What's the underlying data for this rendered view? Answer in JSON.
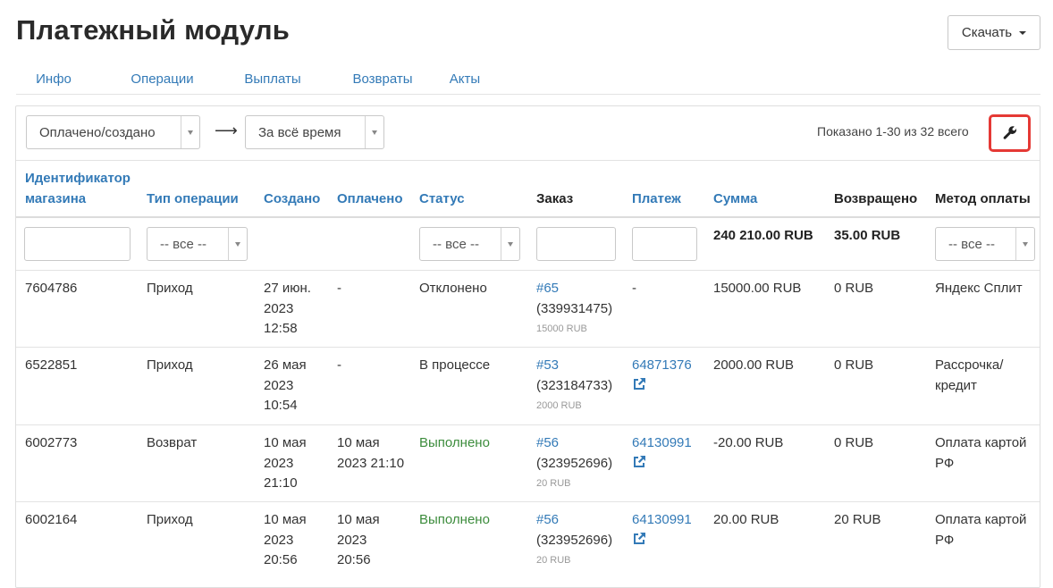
{
  "title": "Платежный модуль",
  "download_label": "Скачать",
  "tabs": [
    {
      "label": "Инфо"
    },
    {
      "label": "Операции"
    },
    {
      "label": "Выплаты"
    },
    {
      "label": "Возвраты"
    },
    {
      "label": "Акты"
    }
  ],
  "active_tab": "Операции",
  "filters": {
    "date_type": "Оплачено/создано",
    "arrow": "⟶",
    "period": "За всё время",
    "shown": "Показано 1-30 из 32 всего"
  },
  "columns": {
    "shop_id": "Идентификатор магазина",
    "op_type": "Тип операции",
    "created": "Создано",
    "paid": "Оплачено",
    "status": "Статус",
    "order": "Заказ",
    "payment": "Платеж",
    "amount": "Сумма",
    "refunded": "Возвращено",
    "method": "Метод оплаты"
  },
  "column_filters": {
    "op_type": "-- все --",
    "status": "-- все --",
    "method": "-- все --"
  },
  "totals": {
    "amount": "240 210.00 RUB",
    "refunded": "35.00 RUB"
  },
  "rows": [
    {
      "shop_id": "7604786",
      "op_type": "Приход",
      "created": [
        "27 июн.",
        "2023",
        "12:58"
      ],
      "paid": [
        "-"
      ],
      "status": "Отклонено",
      "status_ok": false,
      "order_link": "#65",
      "order_id": "(339931475)",
      "order_sum": "15000 RUB",
      "payment": "-",
      "payment_link": false,
      "amount": "15000.00 RUB",
      "refunded": "0 RUB",
      "method": [
        "Яндекс Сплит"
      ]
    },
    {
      "shop_id": "6522851",
      "op_type": "Приход",
      "created": [
        "26 мая",
        "2023",
        "10:54"
      ],
      "paid": [
        "-"
      ],
      "status": "В процессе",
      "status_ok": false,
      "order_link": "#53",
      "order_id": "(323184733)",
      "order_sum": "2000 RUB",
      "payment": "64871376",
      "payment_link": true,
      "amount": "2000.00 RUB",
      "refunded": "0 RUB",
      "method": [
        "Рассрочка/",
        "кредит"
      ]
    },
    {
      "shop_id": "6002773",
      "op_type": "Возврат",
      "created": [
        "10 мая",
        "2023",
        "21:10"
      ],
      "paid": [
        "10 мая",
        "2023 21:10"
      ],
      "status": "Выполнено",
      "status_ok": true,
      "order_link": "#56",
      "order_id": "(323952696)",
      "order_sum": "20 RUB",
      "payment": "64130991",
      "payment_link": true,
      "amount": "-20.00 RUB",
      "refunded": "0 RUB",
      "method": [
        "Оплата картой",
        "РФ"
      ]
    },
    {
      "shop_id": "6002164",
      "op_type": "Приход",
      "created": [
        "10 мая",
        "2023",
        "20:56"
      ],
      "paid": [
        "10 мая",
        "2023",
        "20:56"
      ],
      "status": "Выполнено",
      "status_ok": true,
      "order_link": "#56",
      "order_id": "(323952696)",
      "order_sum": "20 RUB",
      "payment": "64130991",
      "payment_link": true,
      "amount": "20.00 RUB",
      "refunded": "20 RUB",
      "method": [
        "Оплата картой",
        "РФ"
      ]
    }
  ],
  "icons": {
    "wrench": "wrench-icon",
    "external_link": "external-link-icon",
    "caret": "caret-down-icon"
  },
  "colors": {
    "link": "#337ab7",
    "success": "#3c8c3c",
    "highlight_border": "#e53935",
    "active_tab_bg": "#eeeeee"
  }
}
